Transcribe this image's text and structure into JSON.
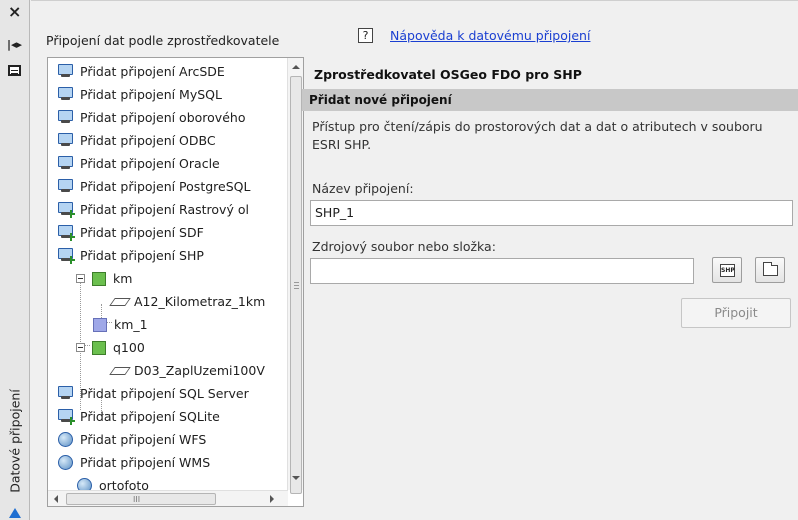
{
  "strip": {
    "close_glyph": "×",
    "pin_glyph": "|◂▸",
    "vertical_title": "Datové připojení"
  },
  "left": {
    "title": "Připojení dat podle zprostředkovatele",
    "tree": [
      {
        "label": "Přidat připojení ArcSDE",
        "icon": "connection-icon"
      },
      {
        "label": "Přidat připojení MySQL",
        "icon": "connection-icon"
      },
      {
        "label": "Přidat připojení oborového",
        "icon": "connection-icon"
      },
      {
        "label": "Přidat připojení ODBC",
        "icon": "connection-icon"
      },
      {
        "label": "Přidat připojení Oracle",
        "icon": "connection-icon"
      },
      {
        "label": "Přidat připojení PostgreSQL",
        "icon": "connection-icon"
      },
      {
        "label": "Přidat připojení Rastrový ol",
        "icon": "connection-add-icon"
      },
      {
        "label": "Přidat připojení SDF",
        "icon": "connection-add-icon"
      },
      {
        "label": "Přidat připojení SHP",
        "icon": "connection-add-icon"
      },
      {
        "label": "km",
        "icon": "feature-class-icon"
      },
      {
        "label": "A12_Kilometraz_1km",
        "icon": "layer-icon"
      },
      {
        "label": "km_1",
        "icon": "feature-class-empty-icon"
      },
      {
        "label": "q100",
        "icon": "feature-class-icon"
      },
      {
        "label": "D03_ZaplUzemi100V",
        "icon": "layer-icon"
      },
      {
        "label": "Přidat připojení SQL Server",
        "icon": "connection-icon"
      },
      {
        "label": "Přidat připojení SQLite",
        "icon": "connection-add-icon"
      },
      {
        "label": "Přidat připojení WFS",
        "icon": "globe-icon"
      },
      {
        "label": "Přidat připojení WMS",
        "icon": "globe-icon"
      },
      {
        "label": "ortofoto",
        "icon": "globe-icon"
      }
    ],
    "hscroll_grip": "III"
  },
  "right": {
    "help_glyph": "?",
    "help_link": "Nápověda k datovému připojení",
    "provider_title": "Zprostředkovatel OSGeo FDO pro SHP",
    "section_title": "Přidat nové připojení",
    "description": "Přístup pro čtení/zápis do prostorových dat a dat o atributech v souboru ESRI SHP.",
    "name_label": "Název připojení:",
    "name_value": "SHP_1",
    "source_label": "Zdrojový soubor nebo složka:",
    "source_value": "",
    "shp_button_text": "SHP",
    "connect_button": "Připojit"
  }
}
